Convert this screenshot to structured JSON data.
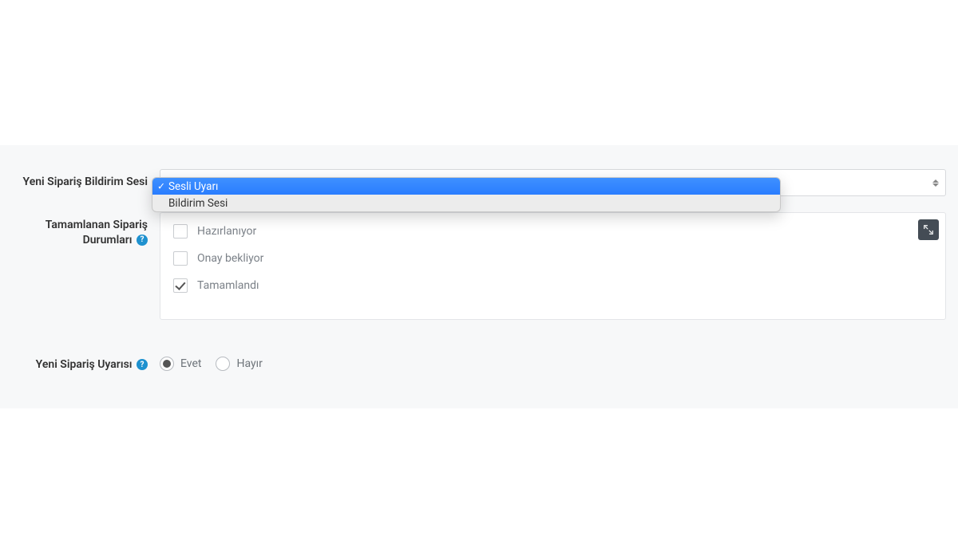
{
  "labels": {
    "sound": "Yeni Sipariş Bildirim Sesi",
    "statuses": "Tamamlanan Sipariş Durumları",
    "alert": "Yeni Sipariş Uyarısı"
  },
  "sound_select": {
    "options": [
      {
        "label": "Sesli Uyarı",
        "selected": true
      },
      {
        "label": "Bildirim Sesi",
        "selected": false
      }
    ]
  },
  "status_checks": [
    {
      "label": "Hazırlanıyor",
      "checked": false
    },
    {
      "label": "Onay bekliyor",
      "checked": false
    },
    {
      "label": "Tamamlandı",
      "checked": true
    }
  ],
  "alert_radio": {
    "yes": "Evet",
    "no": "Hayır",
    "value": "yes"
  }
}
